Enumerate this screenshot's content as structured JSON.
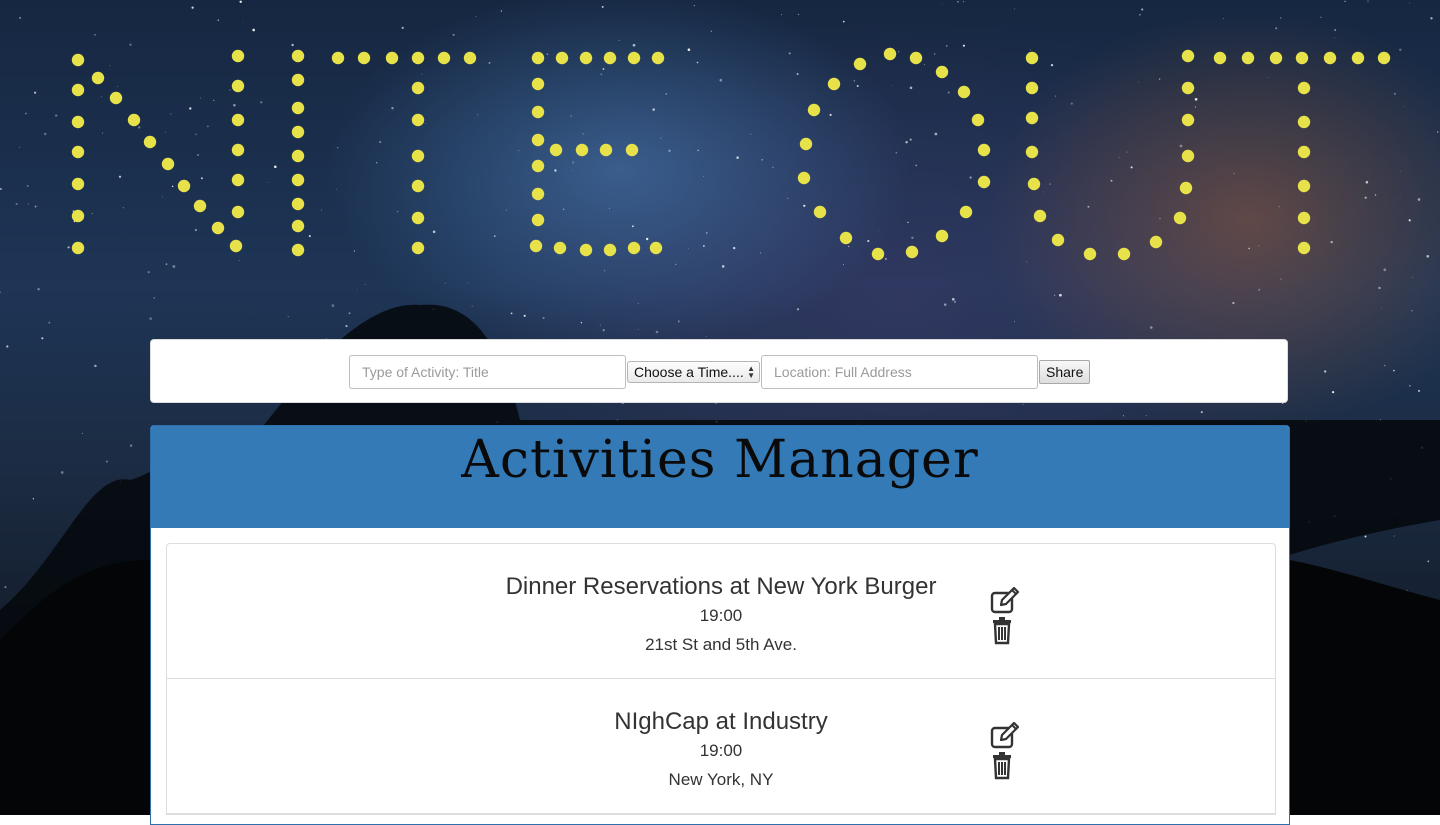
{
  "logo": {
    "letters": [
      "N",
      "I",
      "T",
      "E",
      "O",
      "U",
      "T"
    ],
    "dot_color": "#e8e24a"
  },
  "form": {
    "title_placeholder": "Type of Activity: Title",
    "time_select_value": "Choose a Time....",
    "location_placeholder": "Location: Full Address",
    "share_label": "Share"
  },
  "panel": {
    "title": "Activities Manager",
    "header_color": "#337ab7"
  },
  "activities": [
    {
      "title": "Dinner Reservations at New York Burger",
      "time": "19:00",
      "location": "21st St and 5th Ave.",
      "edit_icon": "edit-icon",
      "delete_icon": "trash-icon"
    },
    {
      "title": "NIghCap at Industry",
      "time": "19:00",
      "location": "New York, NY",
      "edit_icon": "edit-icon",
      "delete_icon": "trash-icon"
    }
  ]
}
